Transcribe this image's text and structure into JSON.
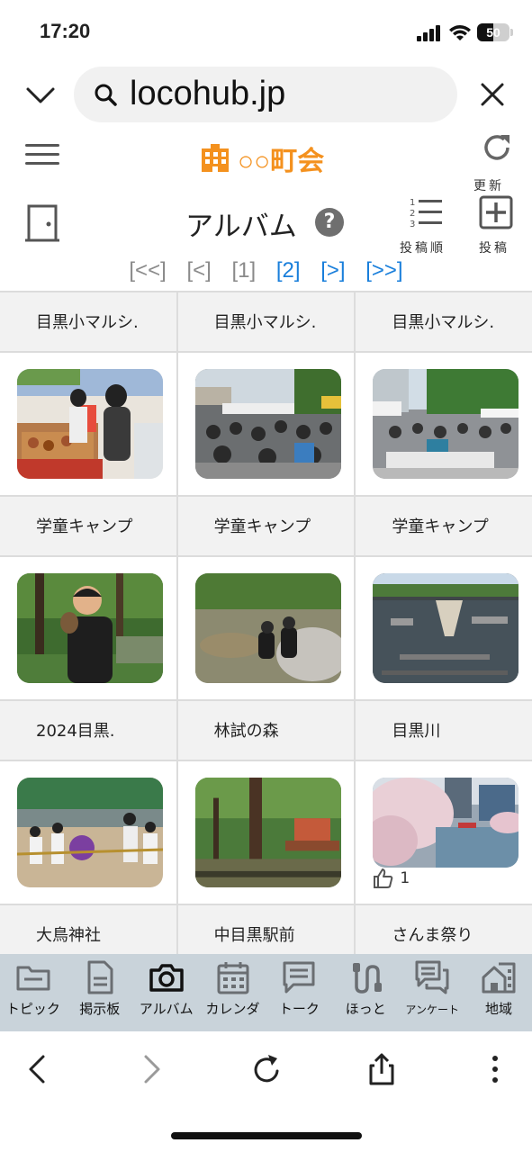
{
  "status": {
    "time": "17:20",
    "battery": "50",
    "battery_level": 0.5
  },
  "browser": {
    "url": "locohub.jp"
  },
  "app": {
    "org_name": "○○町会",
    "refresh_label": "更新",
    "page_title": "アルバム",
    "help": "?",
    "sort_label": "投稿順",
    "post_label": "投稿",
    "brand_color": "#f4911e",
    "link_color": "#1a7fdb"
  },
  "pager": [
    "[<<]",
    "[<]",
    "[1]",
    "[2]",
    "[>]",
    "[>>]"
  ],
  "albums": [
    {
      "title": "目黒小マルシ.",
      "photo": "market-stall",
      "likes": ""
    },
    {
      "title": "目黒小マルシ.",
      "photo": "festival-crowd",
      "likes": ""
    },
    {
      "title": "目黒小マルシ.",
      "photo": "tents-crowd",
      "likes": ""
    },
    {
      "title": "学童キャンプ",
      "photo": "boy-forest",
      "likes": ""
    },
    {
      "title": "学童キャンプ",
      "photo": "kids-river",
      "likes": ""
    },
    {
      "title": "学童キャンプ",
      "photo": "river-stones",
      "likes": ""
    },
    {
      "title": "2024目黒.",
      "photo": "tug-of-war",
      "likes": ""
    },
    {
      "title": "林試の森",
      "photo": "park-trees",
      "likes": ""
    },
    {
      "title": "目黒川",
      "photo": "cherry-blossoms",
      "likes": "1"
    },
    {
      "title": "大鳥神社",
      "photo": "",
      "likes": ""
    },
    {
      "title": "中目黒駅前",
      "photo": "",
      "likes": ""
    },
    {
      "title": "さんま祭り",
      "photo": "",
      "likes": ""
    }
  ],
  "tabs": [
    {
      "label": "トピック",
      "icon": "folder-icon"
    },
    {
      "label": "掲示板",
      "icon": "document-icon"
    },
    {
      "label": "アルバム",
      "icon": "camera-icon"
    },
    {
      "label": "カレンダ",
      "icon": "calendar-icon"
    },
    {
      "label": "トーク",
      "icon": "chat-icon"
    },
    {
      "label": "ほっと",
      "icon": "hotline-icon"
    },
    {
      "label": "アンケート",
      "icon": "survey-icon"
    },
    {
      "label": "地域",
      "icon": "house-icon"
    }
  ]
}
